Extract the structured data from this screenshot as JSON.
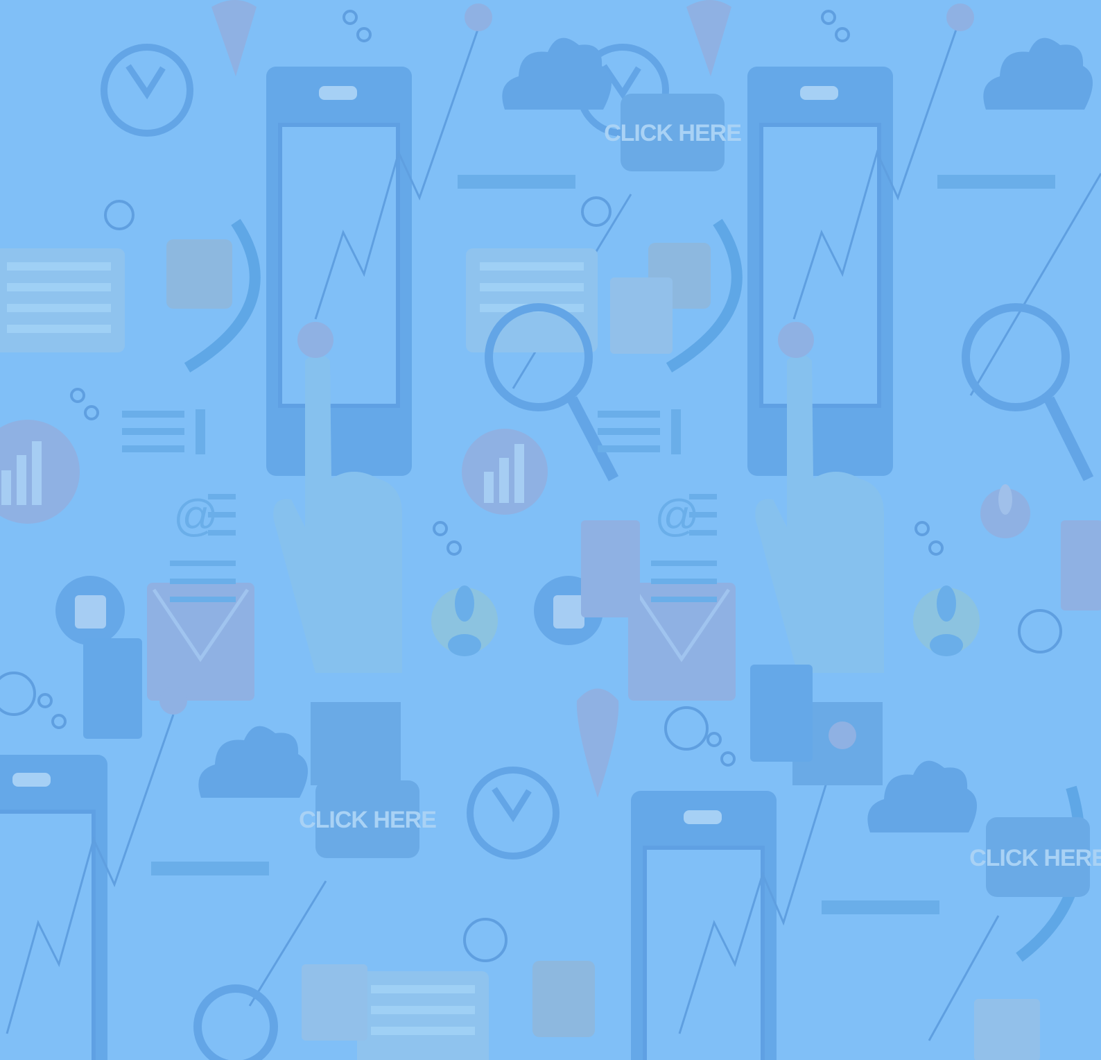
{
  "background": {
    "color": "#80bff7",
    "motif_color": "#5fa6e8",
    "light_motif_color": "#8cc6f3",
    "accent_color": "#9da7dd"
  },
  "buttons": [
    {
      "label": "CLICK HERE"
    },
    {
      "label": "CLICK HERE"
    },
    {
      "label": "CLICK HERE"
    }
  ],
  "icons": [
    "clock-icon",
    "smartphone-icon",
    "pointing-hand-icon",
    "cloud-icon",
    "chat-bubble-icon",
    "magnifier-icon",
    "email-icon",
    "thumbs-up-icon",
    "user-icon",
    "bar-chart-icon",
    "location-pin-icon",
    "coins-icon"
  ]
}
